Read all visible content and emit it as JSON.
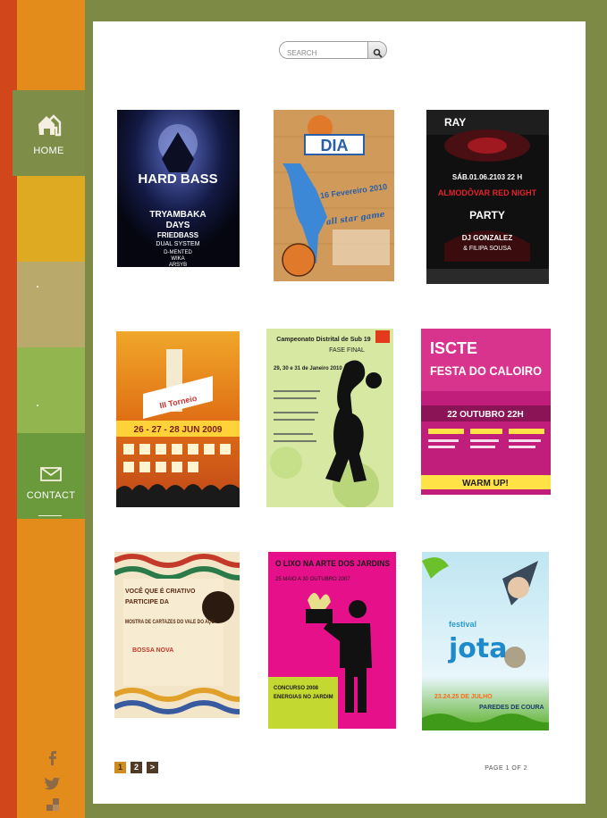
{
  "nav": {
    "home_label": "HOME",
    "contact_label": "CONTACT"
  },
  "social": [
    "facebook-icon",
    "twitter-icon",
    "delicious-icon"
  ],
  "search": {
    "placeholder": "SEARCH"
  },
  "posters": [
    {
      "name": "poster-hard-bass",
      "headline": "HARD BASS",
      "lines": [
        "TRYAMBAKA",
        "DAYS",
        "FRIEDBASS",
        "DUAL SYSTEM",
        "D-MENTED",
        "WIKA",
        "ARSYB"
      ]
    },
    {
      "name": "poster-dia-all-star-game",
      "headline": "DIA",
      "sub": "16 Fevereiro 2010",
      "tag": "all star game"
    },
    {
      "name": "poster-red-night-party",
      "top": "RAY",
      "date": "SÁB.01.06.2103 22 H",
      "headline": "ALMODÔVAR RED NIGHT",
      "party": "PARTY",
      "dj": "DJ GONZALEZ",
      "dj2": "& FILIPA SOUSA"
    },
    {
      "name": "poster-torneio-orquet",
      "headline": "III Torneio",
      "dates": "26 - 27 - 28 JUN 2009"
    },
    {
      "name": "poster-campeonato-distrital",
      "headline": "Campeonato Distrital de Sub 19",
      "sub": "FASE FINAL",
      "dates": "29, 30 e 31 de Janeiro 2010"
    },
    {
      "name": "poster-iscte-festa-caloiro",
      "brand": "ISCTE",
      "headline": "FESTA DO CALOIRO",
      "date": "22 OUTUBRO 22H",
      "sub": "WARM UP!"
    },
    {
      "name": "poster-mostra-cartazes",
      "line1": "VOCÊ QUE É CRIATIVO",
      "line2": "PARTICIPE DA",
      "headline": "MOSTRA DE CARTAZES DO VALE DO AÇO",
      "tag": "BOSSA NOVA"
    },
    {
      "name": "poster-lixo-na-arte",
      "headline": "O LIXO NA ARTE DOS JARDINS",
      "sub": "25 MAIO A 30 OUTUBRO 2007",
      "concurso": "CONCURSO 2008",
      "energias": "ENERGIAS NO JARDIM"
    },
    {
      "name": "poster-festival-jota",
      "brand": "festival",
      "headline": "jota",
      "dates": "23.24.25 DE JULHO",
      "place": "PAREDES DE COURA"
    }
  ],
  "pagination": {
    "pages": [
      "1",
      "2",
      ">"
    ],
    "current": "1",
    "summary": "PAGE 1 OF 2"
  },
  "colors": {
    "background": "#7d8a45",
    "stripe_red": "#d2461c",
    "stripe_orange": "#e48c1b",
    "nav_home": "#7e8d48",
    "nav_contact": "#6a9a3b",
    "pager_active": "#d08d1e",
    "pager_normal": "#4e3a25"
  }
}
